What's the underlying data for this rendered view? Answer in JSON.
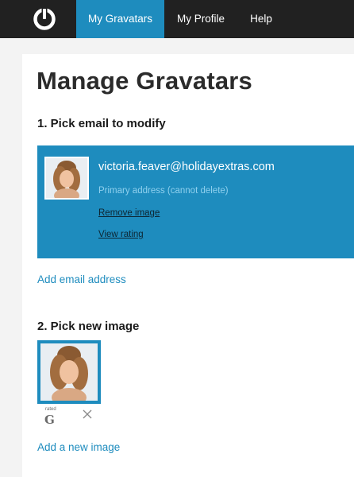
{
  "nav": {
    "items": [
      {
        "label": "My Gravatars",
        "active": true
      },
      {
        "label": "My Profile",
        "active": false
      },
      {
        "label": "Help",
        "active": false
      }
    ]
  },
  "page": {
    "title": "Manage Gravatars"
  },
  "section1": {
    "title": "1. Pick email to modify",
    "email": {
      "address": "victoria.feaver@holidayextras.com",
      "status": "Primary address (cannot delete)",
      "remove_label": "Remove image",
      "rating_label": "View rating"
    },
    "add_email_label": "Add email address"
  },
  "section2": {
    "title": "2. Pick new image",
    "rating_icon": {
      "small_text": "rated",
      "letter": "G"
    },
    "add_image_label": "Add a new image"
  },
  "colors": {
    "accent": "#1e8cbe",
    "topbar": "#212121"
  },
  "icons": {
    "logo": "gravatar-logo-icon",
    "rating": "rating-g-icon",
    "delete": "close-icon"
  }
}
